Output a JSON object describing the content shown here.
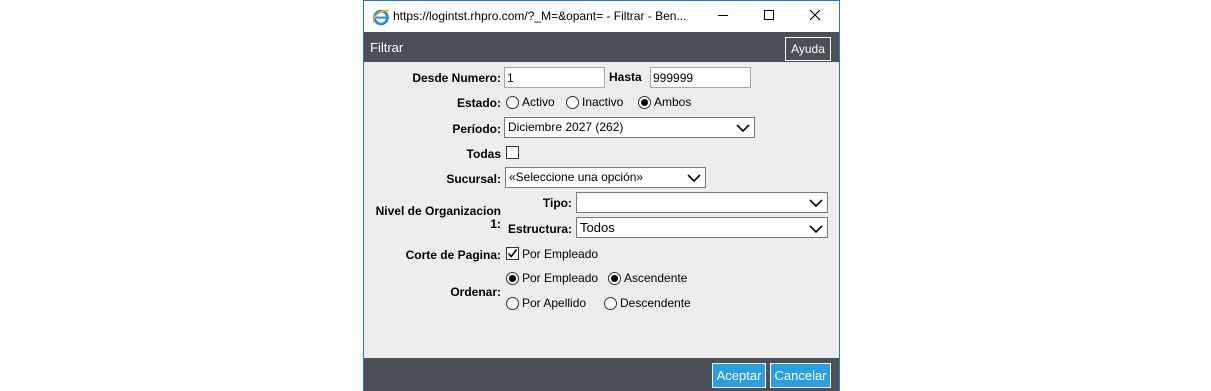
{
  "window": {
    "title": "https://logintst.rhpro.com/?_M=&opant= - Filtrar - Ben..."
  },
  "header": {
    "title": "Filtrar",
    "help_label": "Ayuda"
  },
  "form": {
    "desde_label": "Desde Numero:",
    "desde_value": "1",
    "hasta_label": "Hasta",
    "hasta_value": "999999",
    "estado_label": "Estado:",
    "estado_options": [
      "Activo",
      "Inactivo",
      "Ambos"
    ],
    "estado_selected": "Ambos",
    "periodo_label": "Período:",
    "periodo_value": "Diciembre 2027 (262)",
    "todas_label": "Todas",
    "todas_checked": false,
    "sucursal_label": "Sucursal:",
    "sucursal_value": "«Seleccione una opción»",
    "nivel_label_line1": "Nivel de Organizacion",
    "nivel_label_line2": "1:",
    "tipo_label": "Tipo:",
    "tipo_value": "",
    "estructura_label": "Estructura:",
    "estructura_value": "Todos",
    "corte_label": "Corte de Pagina:",
    "corte_option": "Por Empleado",
    "corte_checked": true,
    "ordenar_label": "Ordenar:",
    "ordenar_by_options": [
      "Por Empleado",
      "Por Apellido"
    ],
    "ordenar_by_selected": "Por Empleado",
    "ordenar_dir_options": [
      "Ascendente",
      "Descendente"
    ],
    "ordenar_dir_selected": "Ascendente"
  },
  "footer": {
    "accept_label": "Aceptar",
    "cancel_label": "Cancelar"
  },
  "icons": {
    "app": "internet-explorer-icon",
    "minimize": "minimize-icon",
    "maximize": "maximize-icon",
    "close": "close-icon",
    "dropdown": "chevron-down-icon",
    "check": "checkmark-icon"
  },
  "colors": {
    "header_bg": "#4b4f58",
    "body_bg": "#ededed",
    "button_blue": "#2b9ee0",
    "window_border": "#1e7ad0"
  }
}
